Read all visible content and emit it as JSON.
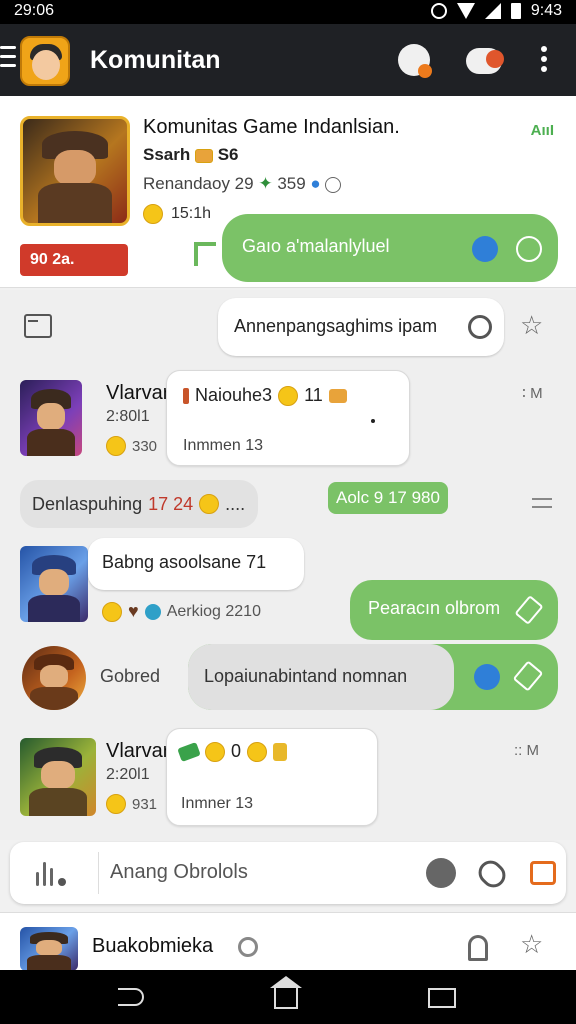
{
  "status_bar": {
    "time_left": "29:06",
    "time_right": "9:43"
  },
  "app_bar": {
    "title": "Komunitan"
  },
  "header": {
    "title": "Komunitas Game Indanlsian.",
    "subtitle": "Ssarh",
    "subtitle_badge": "S6",
    "stats": "Renandaoy 29",
    "stats_count": "359",
    "emoji_text": "15:1h",
    "signal_text": "AııI",
    "red_badge": "90 2a.",
    "pill_text": "Gaıo a'malanlyluel"
  },
  "chat": {
    "pinned_message": "Annenpangsaghims ipam",
    "msg1": {
      "name": "Vlarvar",
      "handle": "2:80l1",
      "count": "330",
      "card_title": "Naiouhe3",
      "card_num": "11",
      "card_sub": "Inmmen 13",
      "time": "∶ M"
    },
    "grey_pill": {
      "text": "Denlaspuhing",
      "num": "17 24",
      "suffix": "...."
    },
    "green_tag": "Aolc  9 17 980",
    "msg2": {
      "text": "Babng asoolsane 71",
      "meta": "Aerkiog 2210"
    },
    "green_pill2": "Pearacın olbrom",
    "msg3": {
      "name": "Gobred",
      "text": "Lopaiunabintand nomnan"
    },
    "msg4": {
      "name": "Vlarvar",
      "handle": "2:20l1",
      "count": "931",
      "card_top": "0",
      "card_sub": "Inmner 13",
      "time": ":: M"
    }
  },
  "input": {
    "placeholder": "Anang Obrolols"
  },
  "bottom_card": {
    "name": "Buakobmieka"
  }
}
